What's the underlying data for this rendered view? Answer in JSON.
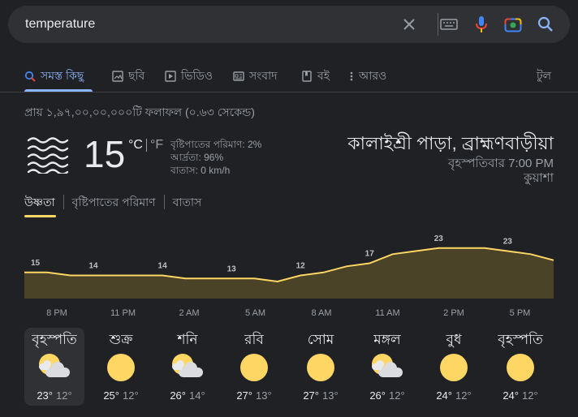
{
  "search": {
    "query": "temperature"
  },
  "tabs": [
    {
      "label": "সমস্ত কিছু",
      "icon": "search-icon"
    },
    {
      "label": "ছবি",
      "icon": "image-icon"
    },
    {
      "label": "ভিডিও",
      "icon": "play-icon"
    },
    {
      "label": "সংবাদ",
      "icon": "news-icon"
    },
    {
      "label": "বই",
      "icon": "book-icon"
    },
    {
      "label": "আরও",
      "icon": "more-vert-icon"
    }
  ],
  "tools_label": "টুল",
  "results_count": "প্রায় ১,৯৭,০০,০০,০০০টি ফলাফল (০.৬৩ সেকেন্ড)",
  "weather": {
    "temperature": "15",
    "unit_c": "°C",
    "unit_f": "°F",
    "precipitation": "বৃষ্টিপাতের পরিমাণ: 2%",
    "humidity": "আর্দ্রতা: 96%",
    "wind": "বাতাস: 0 km/h",
    "location": "কালাইশ্রী পাড়া, ব্রাহ্মণবাড়ীয়া",
    "time": "বৃহস্পতিবার 7:00 PM",
    "condition": "কুয়াশা",
    "accent_color": "#fdd663"
  },
  "subtabs": [
    "উষ্ণতা",
    "বৃষ্টিপাতের পরিমাণ",
    "বাতাস"
  ],
  "chart_data": {
    "type": "area",
    "x": [
      "8 PM",
      "",
      "",
      "11 PM",
      "",
      "",
      "2 AM",
      "",
      "",
      "5 AM",
      "",
      "",
      "8 AM",
      "",
      "",
      "11 AM",
      "",
      "",
      "2 PM",
      "",
      "",
      "5 PM",
      "",
      ""
    ],
    "values": [
      15,
      15,
      14,
      14,
      14,
      14,
      14,
      13,
      13,
      13,
      13,
      12,
      14,
      15,
      17,
      18,
      21,
      22,
      23,
      23,
      23,
      22,
      21,
      19
    ],
    "labels": [
      {
        "index": 0,
        "text": "15"
      },
      {
        "index": 3,
        "text": "14"
      },
      {
        "index": 6,
        "text": "14"
      },
      {
        "index": 9,
        "text": "13"
      },
      {
        "index": 12,
        "text": "12"
      },
      {
        "index": 15,
        "text": "17"
      },
      {
        "index": 18,
        "text": "23"
      },
      {
        "index": 21,
        "text": "23"
      }
    ],
    "tick_labels": [
      "8 PM",
      "11 PM",
      "2 AM",
      "5 AM",
      "8 AM",
      "11 AM",
      "2 PM",
      "5 PM"
    ],
    "line_color": "#fdd663",
    "fill_color": "#4a4328"
  },
  "forecast": [
    {
      "day": "বৃহস্পতি",
      "icon": "partly-cloudy-icon",
      "hi": "23°",
      "lo": "12°",
      "selected": true
    },
    {
      "day": "শুক্র",
      "icon": "sunny-icon",
      "hi": "25°",
      "lo": "12°"
    },
    {
      "day": "শনি",
      "icon": "partly-cloudy-icon",
      "hi": "26°",
      "lo": "14°"
    },
    {
      "day": "রবি",
      "icon": "sunny-icon",
      "hi": "27°",
      "lo": "13°"
    },
    {
      "day": "সোম",
      "icon": "sunny-icon",
      "hi": "27°",
      "lo": "13°"
    },
    {
      "day": "মঙ্গল",
      "icon": "partly-cloudy-icon",
      "hi": "26°",
      "lo": "12°"
    },
    {
      "day": "বুধ",
      "icon": "sunny-icon",
      "hi": "24°",
      "lo": "12°"
    },
    {
      "day": "বৃহস্পতি",
      "icon": "sunny-icon",
      "hi": "24°",
      "lo": "12°"
    }
  ]
}
